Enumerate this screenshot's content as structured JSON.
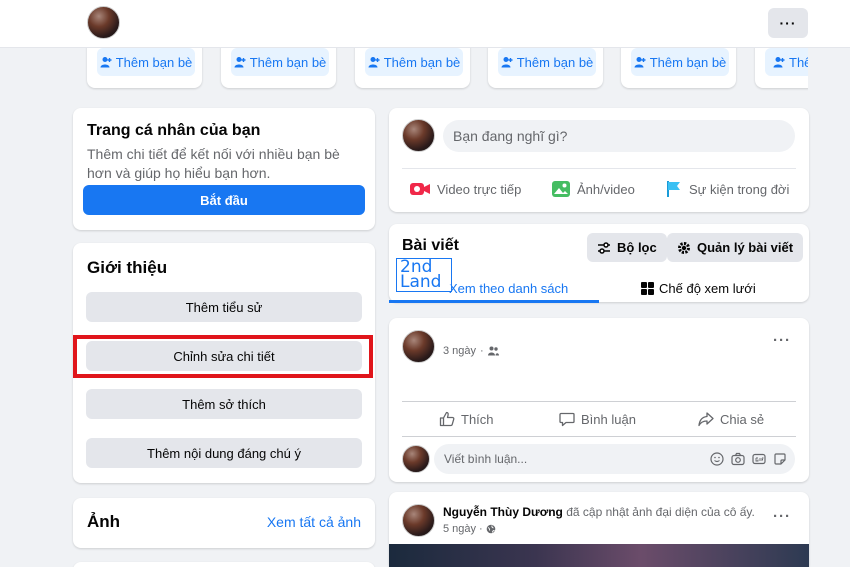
{
  "friend_suggestions": {
    "add_friend_label": "Thêm bạn bè",
    "partial_label": "Thê"
  },
  "profile_card": {
    "title": "Trang cá nhân của bạn",
    "description": "Thêm chi tiết để kết nối với nhiều bạn bè hơn và giúp họ hiểu bạn hơn.",
    "start_button": "Bắt đầu"
  },
  "intro": {
    "title": "Giới thiệu",
    "buttons": [
      "Thêm tiểu sử",
      "Chỉnh sửa chi tiết",
      "Thêm sở thích",
      "Thêm nội dung đáng chú ý"
    ]
  },
  "photos": {
    "title": "Ảnh",
    "see_all": "Xem tất cả ảnh"
  },
  "composer": {
    "placeholder": "Bạn đang nghĩ gì?",
    "actions": [
      "Video trực tiếp",
      "Ảnh/video",
      "Sự kiện trong đời"
    ]
  },
  "posts": {
    "title": "Bài viết",
    "filter_button": "Bộ lọc",
    "manage_button": "Quản lý bài viết",
    "tab_list": "Xem theo danh sách",
    "tab_grid": "Chế độ xem lưới"
  },
  "watermark": {
    "line1": "2nd",
    "line2": "Land"
  },
  "post1": {
    "time": "3 ngày",
    "actions": [
      "Thích",
      "Bình luận",
      "Chia sẻ"
    ],
    "comment_placeholder": "Viết bình luận..."
  },
  "post2": {
    "author": "Nguyễn Thùy Dương",
    "activity": "đã cập nhật ảnh đại diện của cô ấy.",
    "time": "5 ngày"
  },
  "colors": {
    "accent": "#1877f2",
    "highlight_box": "#e0151b",
    "background": "#f0f2f5"
  }
}
